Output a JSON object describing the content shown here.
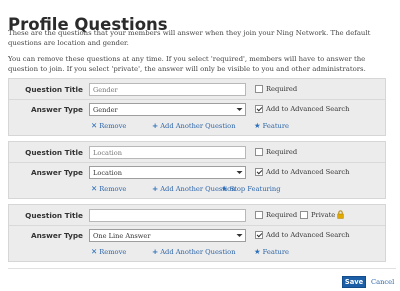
{
  "page": {
    "title": "Profile Questions",
    "intro_1": "These are the questions that your members will answer when they join your Ning Network. The default questions are location and gender.",
    "intro_2": "You can remove these questions at any time. If you select 'required', members will have to answer the question to join. If you select 'private', the answer will only be visible to you and other administrators."
  },
  "labels": {
    "question_title": "Question Title",
    "answer_type": "Answer Type",
    "required": "Required",
    "private": "Private",
    "add_to_advanced_search": "Add to Advanced Search",
    "remove": "Remove",
    "add_another_question": "Add Another Question",
    "feature": "Feature",
    "stop_featuring": "Stop Featuring"
  },
  "questions": [
    {
      "title_placeholder": "Gender",
      "title_value": "",
      "answer_type": "Gender",
      "required": false,
      "advanced_search": true,
      "feature_action": "Feature"
    },
    {
      "title_placeholder": "Location",
      "title_value": "",
      "answer_type": "Location",
      "required": false,
      "advanced_search": true,
      "feature_action": "Stop Featuring"
    },
    {
      "title_placeholder": "",
      "title_value": "",
      "answer_type": "One Line Answer",
      "required": false,
      "private": false,
      "advanced_search": true,
      "feature_action": "Feature"
    }
  ],
  "footer": {
    "save_label": "Save",
    "cancel_label": "Cancel"
  },
  "colors": {
    "accent_link": "#2b64a8",
    "save_button": "#1d5fa6",
    "block_background": "#ececec",
    "lock_icon": "#d9a300"
  },
  "icons": {
    "remove": "x-icon",
    "add": "plus-icon",
    "feature": "star-icon",
    "stop_featuring": "star-off-icon",
    "private": "lock-icon"
  }
}
